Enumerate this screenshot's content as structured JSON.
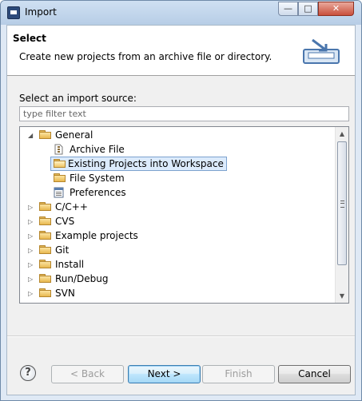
{
  "window": {
    "title": "Import"
  },
  "header": {
    "title": "Select",
    "description": "Create new projects from an archive file or directory."
  },
  "source": {
    "label": "Select an import source:",
    "filter_placeholder": "type filter text"
  },
  "tree": {
    "general": "General",
    "general_children": [
      "Archive File",
      "Existing Projects into Workspace",
      "File System",
      "Preferences"
    ],
    "selected": "Existing Projects into Workspace",
    "folders": [
      "C/C++",
      "CVS",
      "Example projects",
      "Git",
      "Install",
      "Run/Debug",
      "SVN"
    ]
  },
  "buttons": {
    "help": "?",
    "back": "< Back",
    "next": "Next >",
    "finish": "Finish",
    "cancel": "Cancel"
  },
  "icons": {
    "app": "eclipse-import-icon",
    "banner": "import-wizard-banner-icon",
    "folder": "folder-icon",
    "archive": "archive-file-icon",
    "project": "open-project-folder-icon",
    "preferences": "preferences-icon"
  },
  "colors": {
    "selection": "#dcebfc",
    "selection_border": "#7da2ce",
    "titlebar": "#b7cde6"
  }
}
